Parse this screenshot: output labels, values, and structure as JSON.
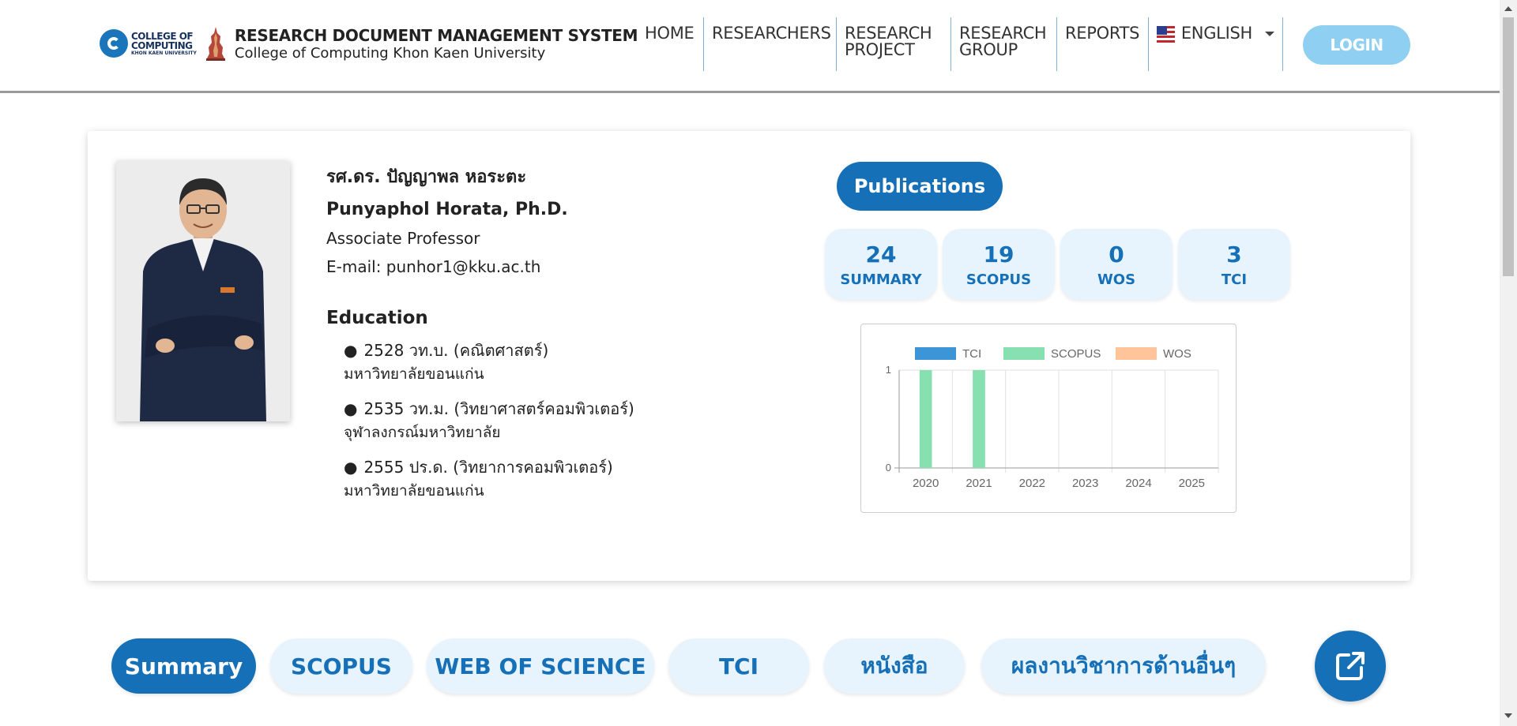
{
  "header": {
    "logo_text": [
      "COLLEGE OF",
      "COMPUTING",
      "KHON KAEN UNIVERSITY"
    ],
    "title": "RESEARCH DOCUMENT MANAGEMENT SYSTEM",
    "subtitle": "College of Computing Khon Kaen University",
    "nav": [
      {
        "line1": "HOME",
        "line2": ""
      },
      {
        "line1": "RESEARCHERS",
        "line2": ""
      },
      {
        "line1": "RESEARCH",
        "line2": "PROJECT"
      },
      {
        "line1": "RESEARCH",
        "line2": "GROUP"
      },
      {
        "line1": "REPORTS",
        "line2": ""
      }
    ],
    "language": "ENGLISH",
    "login_label": "LOGIN",
    "colors": {
      "accent": "#1670b7",
      "login": "#8fd0f2"
    }
  },
  "profile": {
    "name_th": "รศ.ดร. ปัญญาพล หอระตะ",
    "name_en": "Punyaphol Horata, Ph.D.",
    "position": "Associate Professor",
    "email": "E-mail: punhor1@kku.ac.th",
    "education_title": "Education",
    "education": [
      {
        "degree": "2528 วท.บ. (คณิตศาสตร์)",
        "university": "มหาวิทยาลัยขอนแก่น"
      },
      {
        "degree": "2535 วท.ม. (วิทยาศาสตร์คอมพิวเตอร์)",
        "university": "จุฬาลงกรณ์มหาวิทยาลัย"
      },
      {
        "degree": "2555 ปร.ด. (วิทยาการคอมพิวเตอร์)",
        "university": "มหาวิทยาลัยขอนแก่น"
      }
    ],
    "bullet": "●"
  },
  "publications": {
    "button_label": "Publications",
    "stats": [
      {
        "value": "24",
        "label": "SUMMARY"
      },
      {
        "value": "19",
        "label": "SCOPUS"
      },
      {
        "value": "0",
        "label": "WOS"
      },
      {
        "value": "3",
        "label": "TCI"
      }
    ]
  },
  "chart_data": {
    "type": "bar",
    "categories": [
      "2020",
      "2021",
      "2022",
      "2023",
      "2024",
      "2025"
    ],
    "series": [
      {
        "name": "TCI",
        "color": "#3d95d8",
        "values": [
          0,
          0,
          0,
          0,
          0,
          0
        ]
      },
      {
        "name": "SCOPUS",
        "color": "#86e0b0",
        "values": [
          1,
          1,
          0,
          0,
          0,
          0
        ]
      },
      {
        "name": "WOS",
        "color": "#ffc49a",
        "values": [
          0,
          0,
          0,
          0,
          0,
          0
        ]
      }
    ],
    "yticks": [
      "0",
      "1"
    ],
    "ylim": [
      0,
      1
    ],
    "grid": true,
    "legend": "top"
  },
  "tabs": {
    "items": [
      "Summary",
      "SCOPUS",
      "WEB OF SCIENCE",
      "TCI",
      "หนังสือ",
      "ผลงานวิชาการด้านอื่นๆ"
    ],
    "active": 0,
    "export_icon": "external-link-icon"
  }
}
